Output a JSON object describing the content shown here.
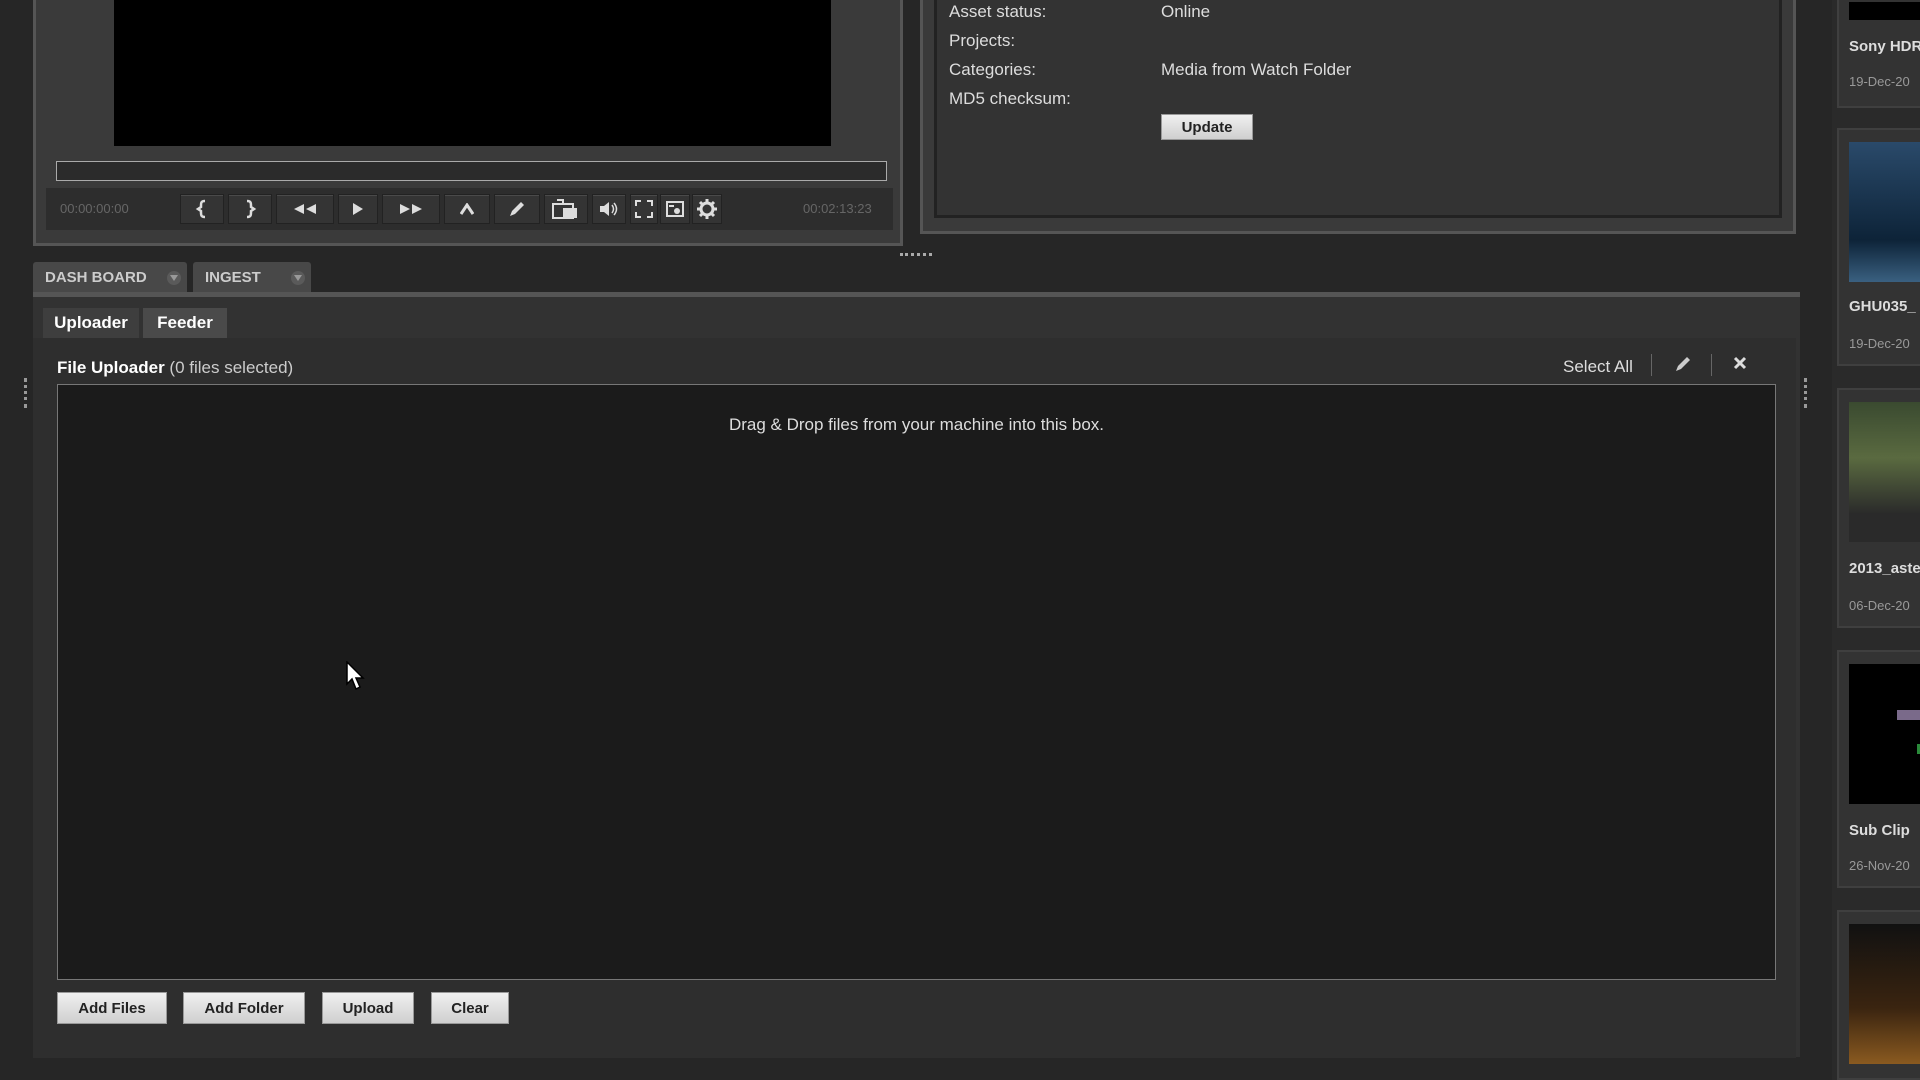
{
  "player": {
    "time_start": "00:00:00:00",
    "time_end": "00:02:13:23",
    "controls": [
      "mark-in-icon",
      "mark-out-icon",
      "rewind-icon",
      "play-icon",
      "fast-forward-icon",
      "up-icon",
      "pencil-icon",
      "subclip-icon",
      "volume-icon",
      "fullscreen-icon",
      "snapshot-icon",
      "settings-icon"
    ]
  },
  "info": {
    "asset_status_label": "Asset status:",
    "asset_status_value": "Online",
    "projects_label": "Projects:",
    "categories_label": "Categories:",
    "categories_value": "Media from Watch Folder",
    "md5_label": "MD5 checksum:",
    "update_label": "Update"
  },
  "tabs": {
    "dashboard": "DASH BOARD",
    "ingest": "INGEST"
  },
  "subtabs": {
    "uploader": "Uploader",
    "feeder": "Feeder"
  },
  "uploader": {
    "title": "File Uploader",
    "count": "(0 files selected)",
    "select_all": "Select All",
    "drop_text": "Drag & Drop files from your machine into this box.",
    "buttons": {
      "add_files": "Add Files",
      "add_folder": "Add Folder",
      "upload": "Upload",
      "clear": "Clear"
    }
  },
  "thumbnails": [
    {
      "title": "Sony HDR",
      "date": "19-Dec-20"
    },
    {
      "title": "GHU035_",
      "date": "19-Dec-20"
    },
    {
      "title": "2013_aste",
      "date": "06-Dec-20"
    },
    {
      "title": "Sub Clip",
      "date": "26-Nov-20"
    }
  ]
}
